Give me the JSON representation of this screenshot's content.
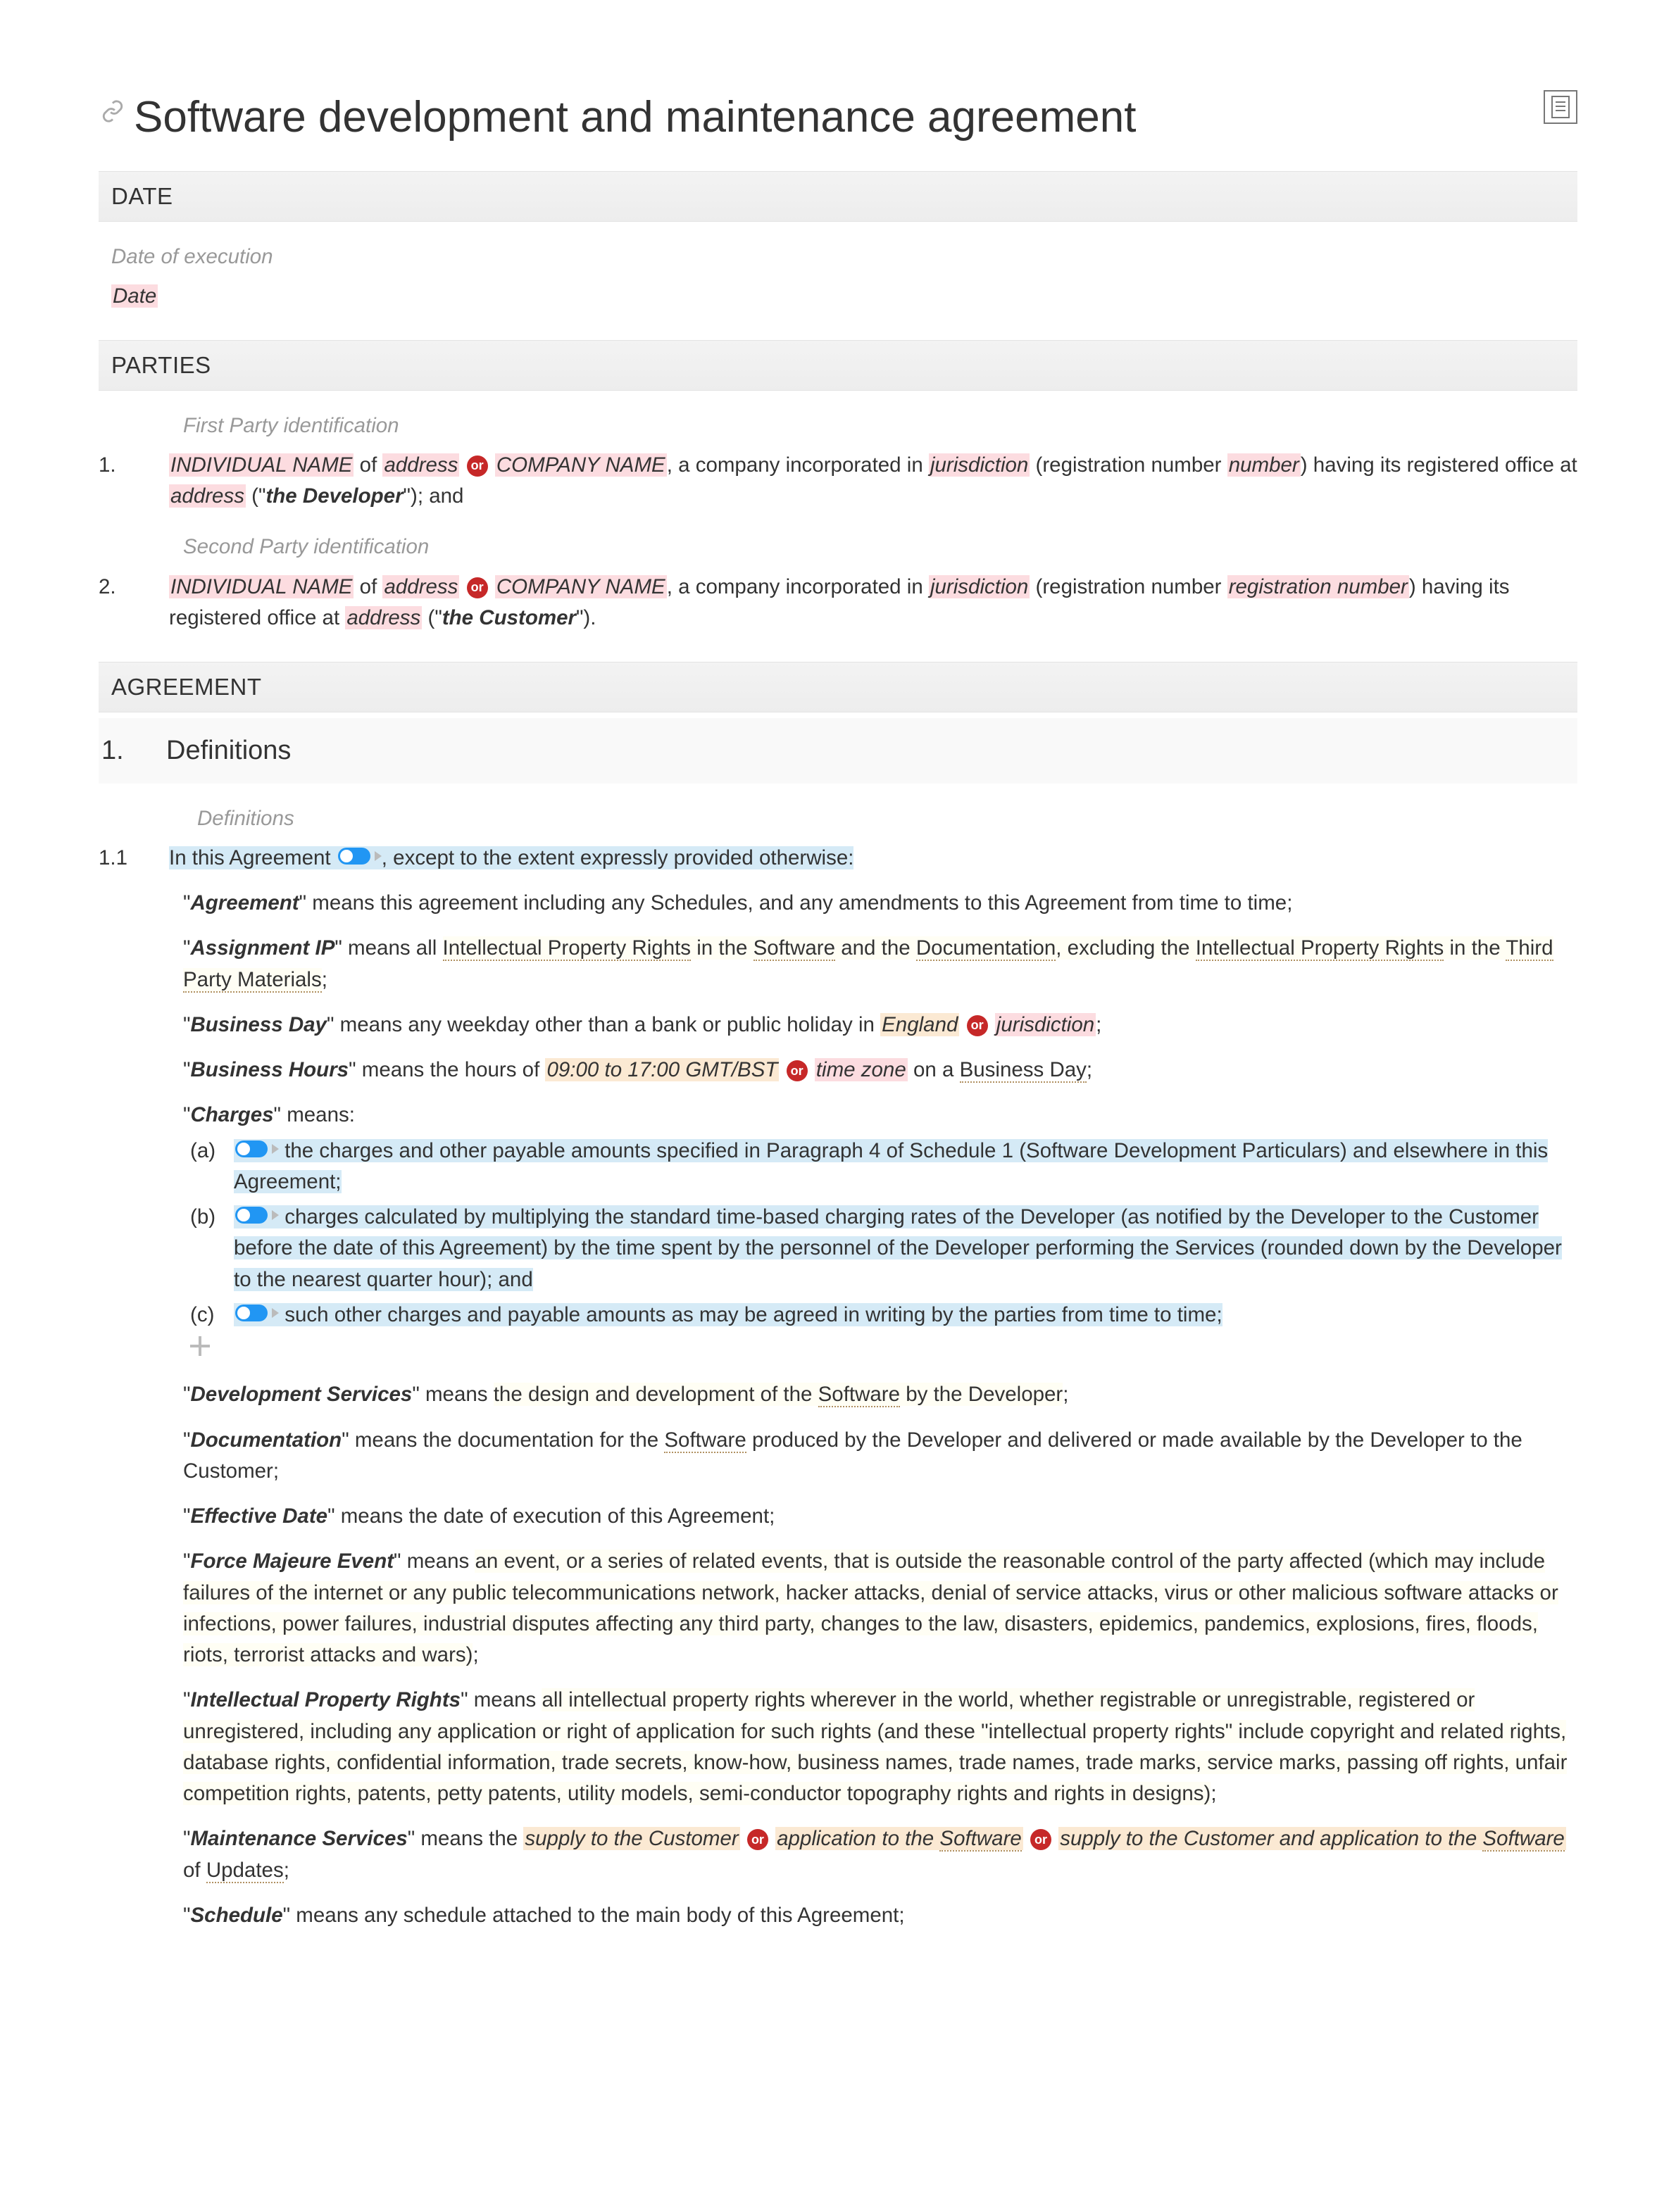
{
  "title": "Software development and maintenance agreement",
  "sections": {
    "date": {
      "heading": "DATE",
      "label": "Date of execution",
      "field": "Date"
    },
    "parties": {
      "heading": "PARTIES",
      "p1_label": "First Party identification",
      "p2_label": "Second Party identification",
      "individual_name": "INDIVIDUAL NAME",
      "of": " of ",
      "address": "address",
      "or": "or",
      "company_name": "COMPANY NAME",
      "inc_prefix": ", a company incorporated in ",
      "jurisdiction": "jurisdiction",
      "reg_open": " (registration number ",
      "number": "number",
      "reg_number": "registration number",
      "close_paren": ")",
      "office_prefix": " having its registered office at ",
      "quote_open": " (\"",
      "quote_close": "\")",
      "developer": "the Developer",
      "and": "; and",
      "customer": "the Customer",
      "period": "."
    },
    "agreement": {
      "heading": "AGREEMENT"
    },
    "defs": {
      "num": "1.",
      "title": "Definitions",
      "label": "Definitions"
    }
  },
  "defs": {
    "n11": "1.1",
    "intro_a": "In this Agreement",
    "intro_b": ", except to the extent expressly provided otherwise:",
    "agreement_term": "Agreement",
    "agreement_body": "\" means this agreement including any Schedules, and any amendments to this Agreement from time to time;",
    "assip_term": "Assignment IP",
    "assip_a": "\" means all ",
    "assip_ipr": "Intellectual Property Rights",
    "assip_b": " in the ",
    "assip_sw": "Software",
    "assip_c": " and the ",
    "assip_doc": "Documentation",
    "assip_d": ", excluding the ",
    "assip_e": " in the ",
    "assip_tpm": "Third Party Materials",
    "assip_f": ";",
    "bday_term": "Business Day",
    "bday_a": "\" means any weekday other than a bank or public holiday in ",
    "bday_england": "England",
    "bday_or": "or",
    "bday_juris": "jurisdiction",
    "bday_b": ";",
    "bhrs_term": "Business Hours",
    "bhrs_a": "\" means the hours of ",
    "bhrs_times": "09:00 to 17:00 GMT/BST",
    "bhrs_or": "or",
    "bhrs_tz": "time zone",
    "bhrs_b": " on a ",
    "bhrs_bd": "Business Day",
    "bhrs_c": ";",
    "charges_term": "Charges",
    "charges_means": "\" means:",
    "ca_lbl": "(a)",
    "ca_body": " the charges and other payable amounts specified in Paragraph 4 of Schedule 1 (Software Development Particulars) and elsewhere in this Agreement;",
    "cb_lbl": "(b)",
    "cb_body": " charges calculated by multiplying the standard time-based charging rates of the Developer (as notified by the Developer to the Customer before the date of this Agreement) by the time spent by the personnel of the Developer performing the Services (rounded down by the Developer to the nearest quarter hour); and",
    "cc_lbl": "(c)",
    "cc_body": " such other charges and payable amounts as may be agreed in writing by the parties from time to time;",
    "devserv_term": "Development Services",
    "devserv_a": "\" means ",
    "devserv_b": "the design and development of the ",
    "devserv_sw": "Software",
    "devserv_c": " by the Developer",
    "devserv_d": ";",
    "docu_term": "Documentation",
    "docu_a": "\" means the documentation for the ",
    "docu_sw": "Software",
    "docu_b": " produced by the Developer and delivered or made available by the Developer to the Customer;",
    "eff_term": "Effective Date",
    "eff_body": "\" means the date of execution of this Agreement;",
    "fm_term": "Force Majeure Event",
    "fm_a": "\" means ",
    "fm_b": "an event, or a series of related events, that is outside the reasonable control of the party affected (which may include failures of the internet or any public telecommunications network, hacker attacks, denial of service attacks, virus or other malicious software attacks or infections, power failures, industrial disputes affecting any third party, changes to the law, disasters, epidemics, pandemics, explosions, fires, floods, riots, terrorist attacks and wars)",
    "fm_c": ";",
    "ipr_term": "Intellectual Property Rights",
    "ipr_a": "\" means ",
    "ipr_b": "all intellectual property rights wherever in the world, whether registrable or unregistrable, registered or unregistered, including any application or right of application for such rights (and these \"intellectual property rights\" include copyright and related rights, database rights, confidential information, trade secrets, know-how, business names, trade names, trade marks, service marks, passing off rights, unfair competition rights, patents, petty patents, utility models, semi-conductor topography rights and rights in designs)",
    "ipr_c": ";",
    "maint_term": "Maintenance Services",
    "maint_a": "\" means the ",
    "maint_opt1": "supply to the Customer",
    "maint_or": "or",
    "maint_opt2": "application to the ",
    "maint_sw": "Software",
    "maint_opt3": "supply to the Customer and application to the ",
    "maint_b": " of ",
    "maint_upd": "Updates",
    "maint_c": ";",
    "sched_term": "Schedule",
    "sched_body": "\" means any schedule attached to the main body of this Agreement;"
  }
}
